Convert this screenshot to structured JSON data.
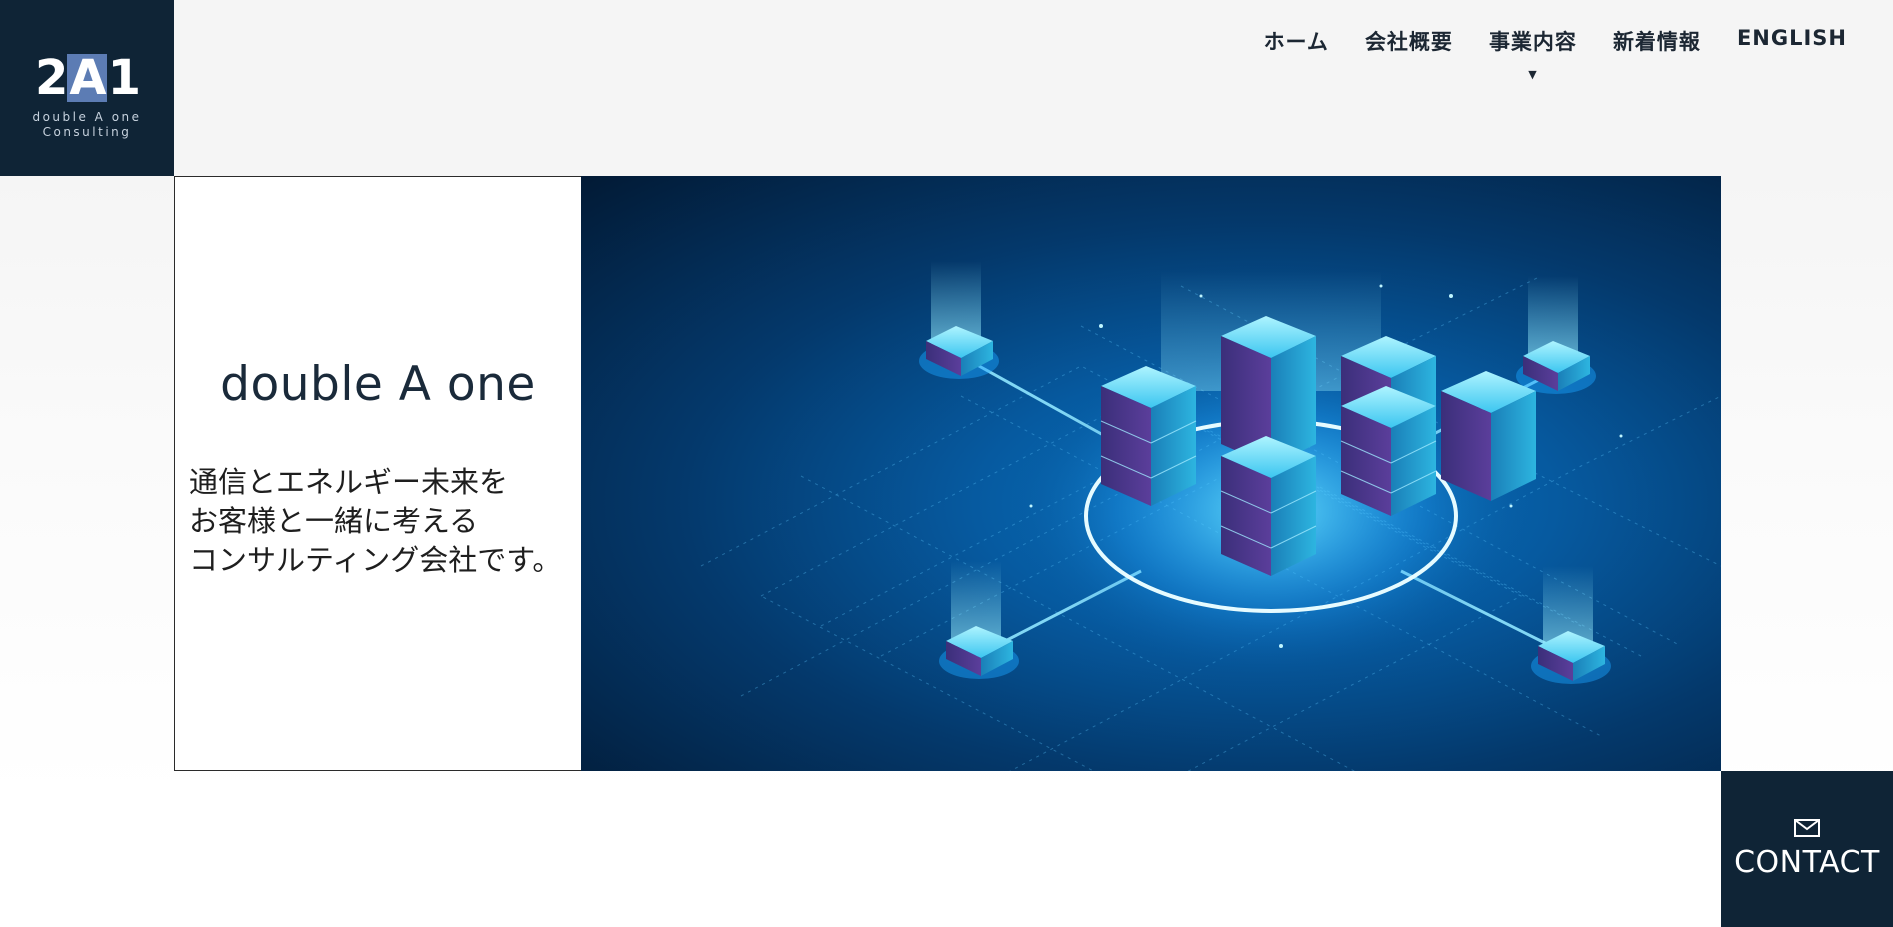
{
  "logo": {
    "mark_left": "2",
    "mark_mid": "A",
    "mark_right": "1",
    "sub_line1": "double A one",
    "sub_line2": "Consulting"
  },
  "nav": {
    "items": [
      {
        "label": "ホーム"
      },
      {
        "label": "会社概要"
      },
      {
        "label": "事業内容",
        "has_dropdown": true
      },
      {
        "label": "新着情報"
      },
      {
        "label": "ENGLISH"
      }
    ]
  },
  "hero": {
    "title": "double A one",
    "copy_line1": "通信とエネルギー未来を",
    "copy_line2": "お客様と一緒に考える",
    "copy_line3": "コンサルティング会社です。",
    "image_icon": "server-network-illustration"
  },
  "contact": {
    "label": "CONTACT",
    "icon": "mail-icon"
  },
  "colors": {
    "brand_dark": "#0f2436",
    "logo_accent": "#5c7cb4",
    "hero_blue": "#0a76c4"
  }
}
